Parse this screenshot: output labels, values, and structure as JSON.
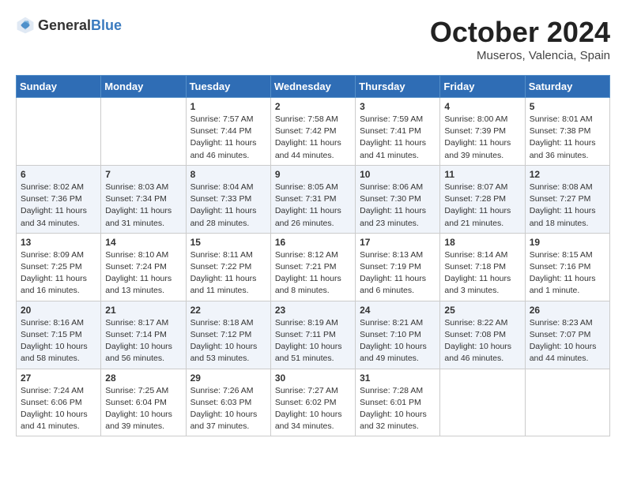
{
  "header": {
    "logo_general": "General",
    "logo_blue": "Blue",
    "month": "October 2024",
    "location": "Museros, Valencia, Spain"
  },
  "weekdays": [
    "Sunday",
    "Monday",
    "Tuesday",
    "Wednesday",
    "Thursday",
    "Friday",
    "Saturday"
  ],
  "weeks": [
    [
      {
        "day": "",
        "info": ""
      },
      {
        "day": "",
        "info": ""
      },
      {
        "day": "1",
        "info": "Sunrise: 7:57 AM\nSunset: 7:44 PM\nDaylight: 11 hours and 46 minutes."
      },
      {
        "day": "2",
        "info": "Sunrise: 7:58 AM\nSunset: 7:42 PM\nDaylight: 11 hours and 44 minutes."
      },
      {
        "day": "3",
        "info": "Sunrise: 7:59 AM\nSunset: 7:41 PM\nDaylight: 11 hours and 41 minutes."
      },
      {
        "day": "4",
        "info": "Sunrise: 8:00 AM\nSunset: 7:39 PM\nDaylight: 11 hours and 39 minutes."
      },
      {
        "day": "5",
        "info": "Sunrise: 8:01 AM\nSunset: 7:38 PM\nDaylight: 11 hours and 36 minutes."
      }
    ],
    [
      {
        "day": "6",
        "info": "Sunrise: 8:02 AM\nSunset: 7:36 PM\nDaylight: 11 hours and 34 minutes."
      },
      {
        "day": "7",
        "info": "Sunrise: 8:03 AM\nSunset: 7:34 PM\nDaylight: 11 hours and 31 minutes."
      },
      {
        "day": "8",
        "info": "Sunrise: 8:04 AM\nSunset: 7:33 PM\nDaylight: 11 hours and 28 minutes."
      },
      {
        "day": "9",
        "info": "Sunrise: 8:05 AM\nSunset: 7:31 PM\nDaylight: 11 hours and 26 minutes."
      },
      {
        "day": "10",
        "info": "Sunrise: 8:06 AM\nSunset: 7:30 PM\nDaylight: 11 hours and 23 minutes."
      },
      {
        "day": "11",
        "info": "Sunrise: 8:07 AM\nSunset: 7:28 PM\nDaylight: 11 hours and 21 minutes."
      },
      {
        "day": "12",
        "info": "Sunrise: 8:08 AM\nSunset: 7:27 PM\nDaylight: 11 hours and 18 minutes."
      }
    ],
    [
      {
        "day": "13",
        "info": "Sunrise: 8:09 AM\nSunset: 7:25 PM\nDaylight: 11 hours and 16 minutes."
      },
      {
        "day": "14",
        "info": "Sunrise: 8:10 AM\nSunset: 7:24 PM\nDaylight: 11 hours and 13 minutes."
      },
      {
        "day": "15",
        "info": "Sunrise: 8:11 AM\nSunset: 7:22 PM\nDaylight: 11 hours and 11 minutes."
      },
      {
        "day": "16",
        "info": "Sunrise: 8:12 AM\nSunset: 7:21 PM\nDaylight: 11 hours and 8 minutes."
      },
      {
        "day": "17",
        "info": "Sunrise: 8:13 AM\nSunset: 7:19 PM\nDaylight: 11 hours and 6 minutes."
      },
      {
        "day": "18",
        "info": "Sunrise: 8:14 AM\nSunset: 7:18 PM\nDaylight: 11 hours and 3 minutes."
      },
      {
        "day": "19",
        "info": "Sunrise: 8:15 AM\nSunset: 7:16 PM\nDaylight: 11 hours and 1 minute."
      }
    ],
    [
      {
        "day": "20",
        "info": "Sunrise: 8:16 AM\nSunset: 7:15 PM\nDaylight: 10 hours and 58 minutes."
      },
      {
        "day": "21",
        "info": "Sunrise: 8:17 AM\nSunset: 7:14 PM\nDaylight: 10 hours and 56 minutes."
      },
      {
        "day": "22",
        "info": "Sunrise: 8:18 AM\nSunset: 7:12 PM\nDaylight: 10 hours and 53 minutes."
      },
      {
        "day": "23",
        "info": "Sunrise: 8:19 AM\nSunset: 7:11 PM\nDaylight: 10 hours and 51 minutes."
      },
      {
        "day": "24",
        "info": "Sunrise: 8:21 AM\nSunset: 7:10 PM\nDaylight: 10 hours and 49 minutes."
      },
      {
        "day": "25",
        "info": "Sunrise: 8:22 AM\nSunset: 7:08 PM\nDaylight: 10 hours and 46 minutes."
      },
      {
        "day": "26",
        "info": "Sunrise: 8:23 AM\nSunset: 7:07 PM\nDaylight: 10 hours and 44 minutes."
      }
    ],
    [
      {
        "day": "27",
        "info": "Sunrise: 7:24 AM\nSunset: 6:06 PM\nDaylight: 10 hours and 41 minutes."
      },
      {
        "day": "28",
        "info": "Sunrise: 7:25 AM\nSunset: 6:04 PM\nDaylight: 10 hours and 39 minutes."
      },
      {
        "day": "29",
        "info": "Sunrise: 7:26 AM\nSunset: 6:03 PM\nDaylight: 10 hours and 37 minutes."
      },
      {
        "day": "30",
        "info": "Sunrise: 7:27 AM\nSunset: 6:02 PM\nDaylight: 10 hours and 34 minutes."
      },
      {
        "day": "31",
        "info": "Sunrise: 7:28 AM\nSunset: 6:01 PM\nDaylight: 10 hours and 32 minutes."
      },
      {
        "day": "",
        "info": ""
      },
      {
        "day": "",
        "info": ""
      }
    ]
  ]
}
